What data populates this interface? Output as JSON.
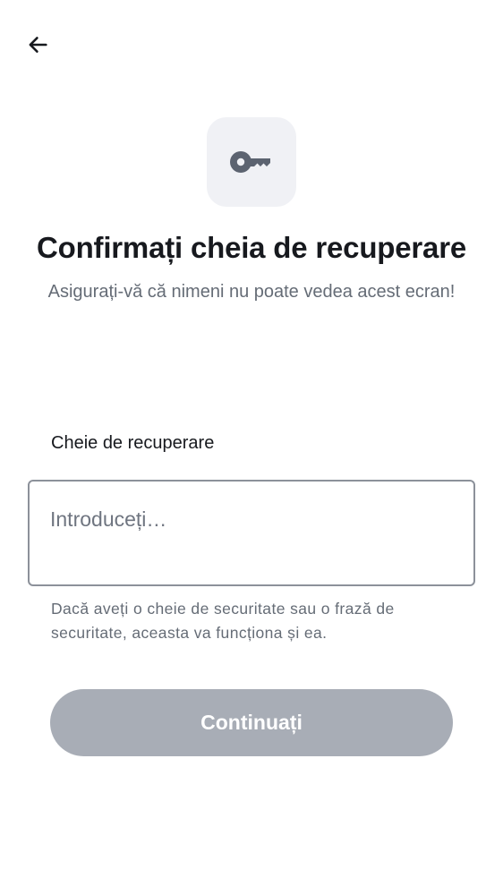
{
  "header": {
    "back_icon": "arrow-left-icon"
  },
  "hero": {
    "icon": "key-icon",
    "title": "Confirmați cheia de recuperare",
    "subtitle": "Asigurați-vă că nimeni nu poate vedea acest ecran!"
  },
  "form": {
    "label": "Cheie de recuperare",
    "value": "",
    "placeholder": "Introduceți…",
    "helper": "Dacă aveți o cheie de securitate sau o frază de securitate, aceasta va funcționa și ea."
  },
  "actions": {
    "continue_label": "Continuați",
    "continue_disabled": true
  },
  "colors": {
    "button_disabled": "#a8adb6",
    "icon_tile": "#f0f1f5",
    "key_icon": "#5c6370",
    "text_primary": "#17191e",
    "text_secondary": "#656c76"
  }
}
